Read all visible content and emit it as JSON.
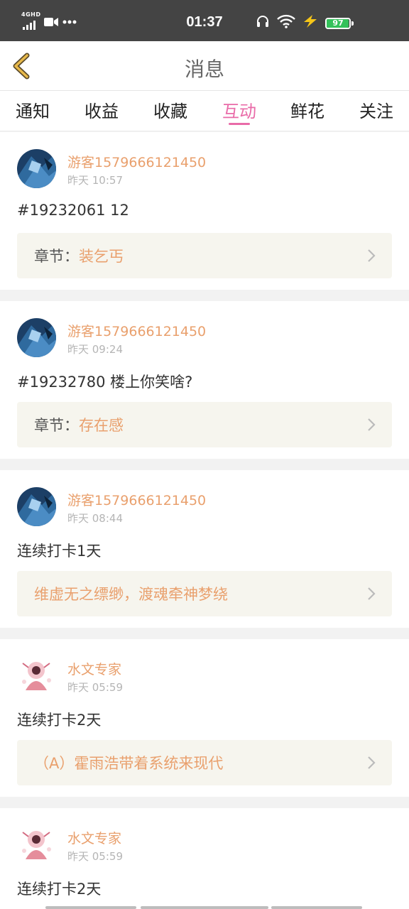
{
  "status_bar": {
    "network": "4GHD",
    "time": "01:37",
    "battery": "97",
    "battery_level": 0.97
  },
  "header": {
    "title": "消息",
    "back_icon": "chevron-left-icon"
  },
  "tabs": [
    {
      "label": "通知",
      "active": false
    },
    {
      "label": "收益",
      "active": false
    },
    {
      "label": "收藏",
      "active": false
    },
    {
      "label": "互动",
      "active": true
    },
    {
      "label": "鲜花",
      "active": false
    },
    {
      "label": "关注",
      "active": false
    }
  ],
  "colors": {
    "accent": "#e96ba8",
    "username": "#e9a06d",
    "status_bar": "#444444",
    "ref_box": "#f6f5ee"
  },
  "messages": [
    {
      "username": "游客1579666121450",
      "time": "昨天 10:57",
      "content": "#19232061 12",
      "ref_prefix": "章节：",
      "ref_value": "装乞丐"
    },
    {
      "username": "游客1579666121450",
      "time": "昨天 09:24",
      "content": "#19232780 楼上你笑啥?",
      "ref_prefix": "章节：",
      "ref_value": "存在感"
    },
    {
      "username": "游客1579666121450",
      "time": "昨天 08:44",
      "content": "连续打卡1天",
      "ref_prefix": "",
      "ref_value": "维虚无之缥缈，渡魂牵神梦绕"
    },
    {
      "username": "水文专家",
      "time": "昨天 05:59",
      "content": "连续打卡2天",
      "ref_prefix": "",
      "ref_value": "（A）霍雨浩带着系统来现代"
    },
    {
      "username": "水文专家",
      "time": "昨天 05:59",
      "content": "连续打卡2天",
      "ref_prefix": "",
      "ref_value": ""
    }
  ]
}
